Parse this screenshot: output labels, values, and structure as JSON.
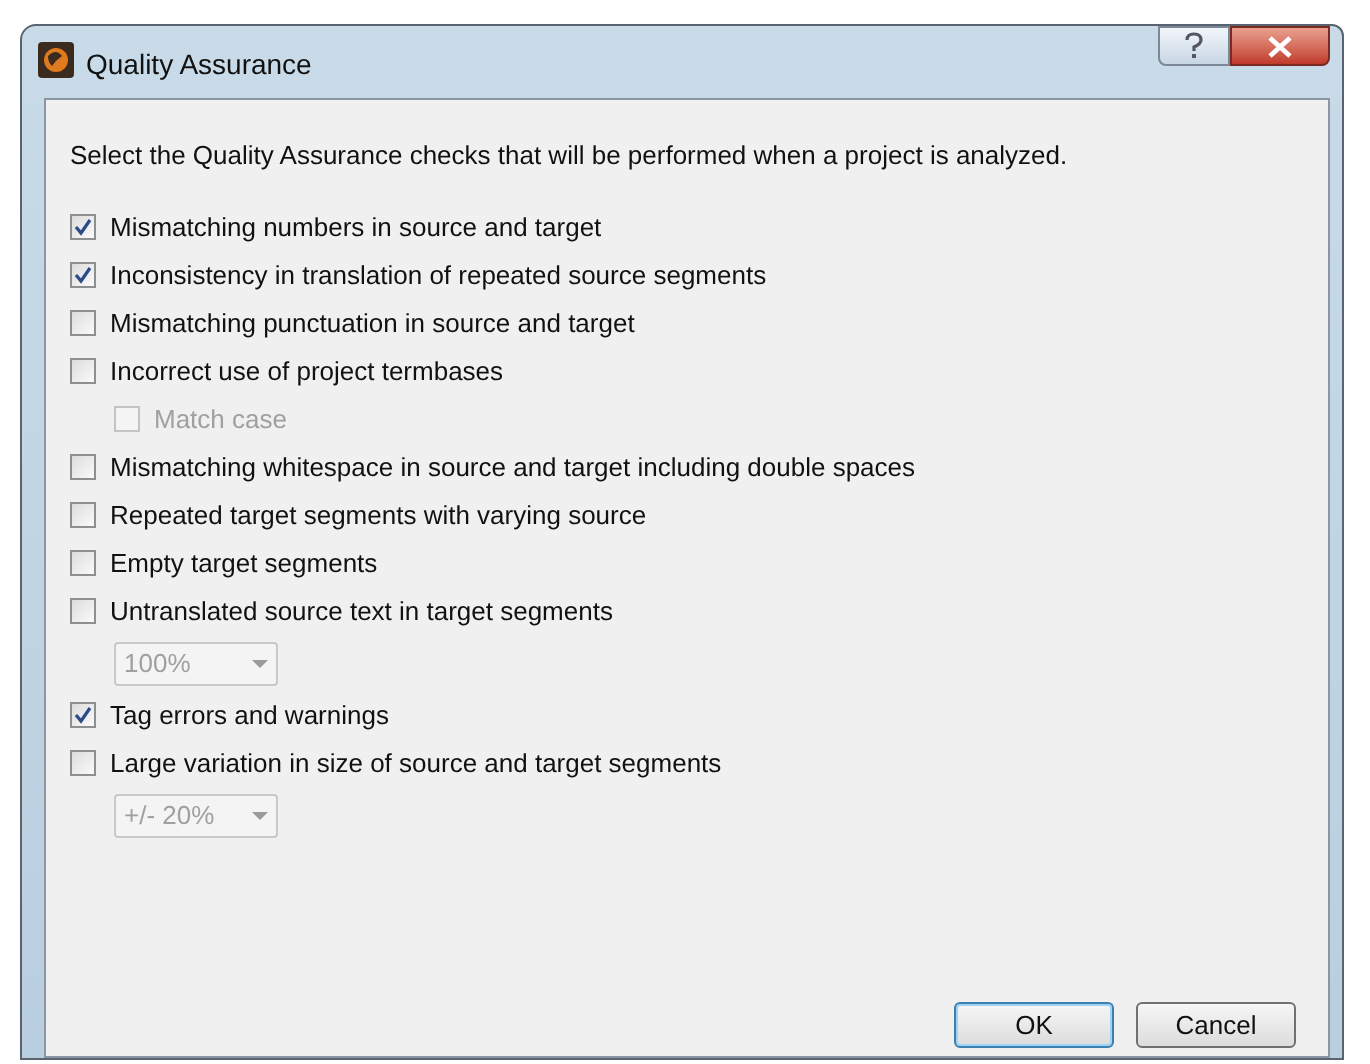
{
  "window": {
    "title": "Quality Assurance"
  },
  "instruction": "Select the Quality Assurance checks that will be performed when a project is analyzed.",
  "checks": [
    {
      "label": "Mismatching numbers in source and target",
      "checked": true,
      "disabled": false
    },
    {
      "label": "Inconsistency in translation of repeated source segments",
      "checked": true,
      "disabled": false
    },
    {
      "label": "Mismatching punctuation in source and target",
      "checked": false,
      "disabled": false
    },
    {
      "label": "Incorrect use of project termbases",
      "checked": false,
      "disabled": false,
      "children": [
        {
          "kind": "checkbox",
          "label": "Match case",
          "checked": false,
          "disabled": true
        }
      ]
    },
    {
      "label": "Mismatching whitespace in source and target including double spaces",
      "checked": false,
      "disabled": false
    },
    {
      "label": "Repeated target segments with varying source",
      "checked": false,
      "disabled": false
    },
    {
      "label": "Empty target segments",
      "checked": false,
      "disabled": false
    },
    {
      "label": "Untranslated source text in target segments",
      "checked": false,
      "disabled": false,
      "children": [
        {
          "kind": "dropdown",
          "value": "100%",
          "disabled": true
        }
      ]
    },
    {
      "label": "Tag errors and warnings",
      "checked": true,
      "disabled": false
    },
    {
      "label": "Large variation in size of source and target segments",
      "checked": false,
      "disabled": false,
      "children": [
        {
          "kind": "dropdown",
          "value": "+/- 20%",
          "disabled": true
        }
      ]
    }
  ],
  "buttons": [
    {
      "label": "OK",
      "default": true
    },
    {
      "label": "Cancel",
      "default": false
    }
  ]
}
